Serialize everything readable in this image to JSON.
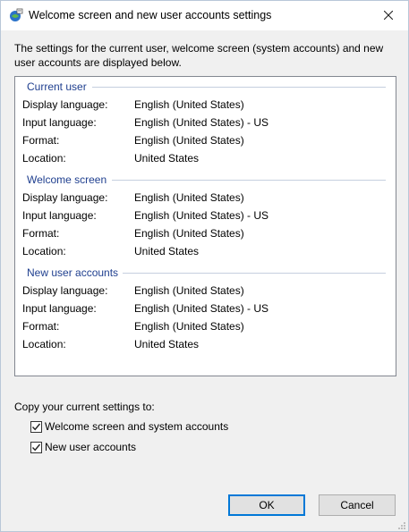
{
  "window": {
    "title": "Welcome screen and new user accounts settings",
    "close_icon": "close-icon",
    "app_icon": "region-settings-icon"
  },
  "intro": "The settings for the current user, welcome screen (system accounts) and new user accounts are displayed below.",
  "sections": [
    {
      "heading": "Current user",
      "rows": [
        {
          "label": "Display language:",
          "value": "English (United States)"
        },
        {
          "label": "Input language:",
          "value": "English (United States) - US"
        },
        {
          "label": "Format:",
          "value": "English (United States)"
        },
        {
          "label": "Location:",
          "value": "United States"
        }
      ]
    },
    {
      "heading": "Welcome screen",
      "rows": [
        {
          "label": "Display language:",
          "value": "English (United States)"
        },
        {
          "label": "Input language:",
          "value": "English (United States) - US"
        },
        {
          "label": "Format:",
          "value": "English (United States)"
        },
        {
          "label": "Location:",
          "value": "United States"
        }
      ]
    },
    {
      "heading": "New user accounts",
      "rows": [
        {
          "label": "Display language:",
          "value": "English (United States)"
        },
        {
          "label": "Input language:",
          "value": "English (United States) - US"
        },
        {
          "label": "Format:",
          "value": "English (United States)"
        },
        {
          "label": "Location:",
          "value": "United States"
        }
      ]
    }
  ],
  "copy": {
    "title": "Copy your current settings to:",
    "options": [
      {
        "label": "Welcome screen and system accounts",
        "checked": true
      },
      {
        "label": "New user accounts",
        "checked": true
      }
    ]
  },
  "buttons": {
    "ok": "OK",
    "cancel": "Cancel"
  },
  "colors": {
    "section_heading": "#1f3f8f",
    "default_button_border": "#0078d7"
  }
}
